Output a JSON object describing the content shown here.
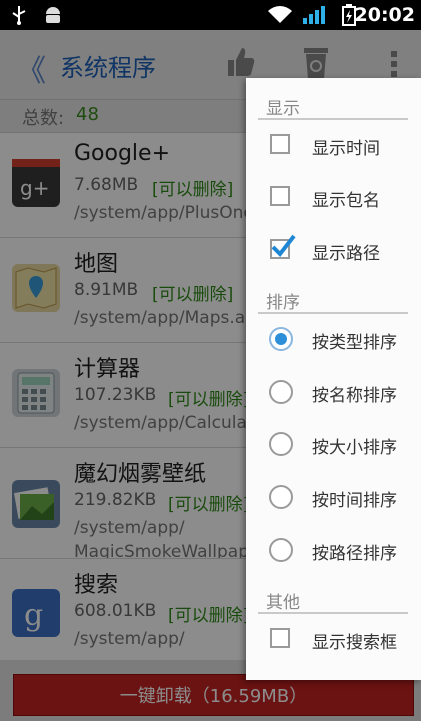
{
  "status_bar": {
    "time": "20:02"
  },
  "titlebar": {
    "back": "《",
    "title": "系统程序"
  },
  "count": {
    "label": "总数:",
    "value": "48"
  },
  "apps": [
    {
      "name": "Google+",
      "size": "7.68MB",
      "tag": "[可以删除]",
      "path": "/system/app/PlusOne.apk"
    },
    {
      "name": "地图",
      "size": "8.91MB",
      "tag": "[可以删除]",
      "path": "/system/app/Maps.apk"
    },
    {
      "name": "计算器",
      "size": "107.23KB",
      "tag": "[可以删除]",
      "path": "/system/app/Calculator.apk"
    },
    {
      "name": "魔幻烟雾壁纸",
      "size": "219.82KB",
      "tag": "[可以删除]",
      "path": "/system/app/",
      "path2": "MagicSmokeWallpapers.apk"
    },
    {
      "name": "搜索",
      "size": "608.01KB",
      "tag": "[可以删除]",
      "path": "/system/app/"
    }
  ],
  "uninstall_label": "一键卸载（16.59MB）",
  "menu": {
    "display": {
      "header": "显示",
      "items": [
        "显示时间",
        "显示包名",
        "显示路径"
      ],
      "checked": [
        false,
        false,
        true
      ]
    },
    "sort": {
      "header": "排序",
      "items": [
        "按类型排序",
        "按名称排序",
        "按大小排序",
        "按时间排序",
        "按路径排序"
      ],
      "selected": "按类型排序"
    },
    "other": {
      "header": "其他",
      "items": [
        "显示搜索框"
      ],
      "checked": [
        false
      ]
    }
  }
}
